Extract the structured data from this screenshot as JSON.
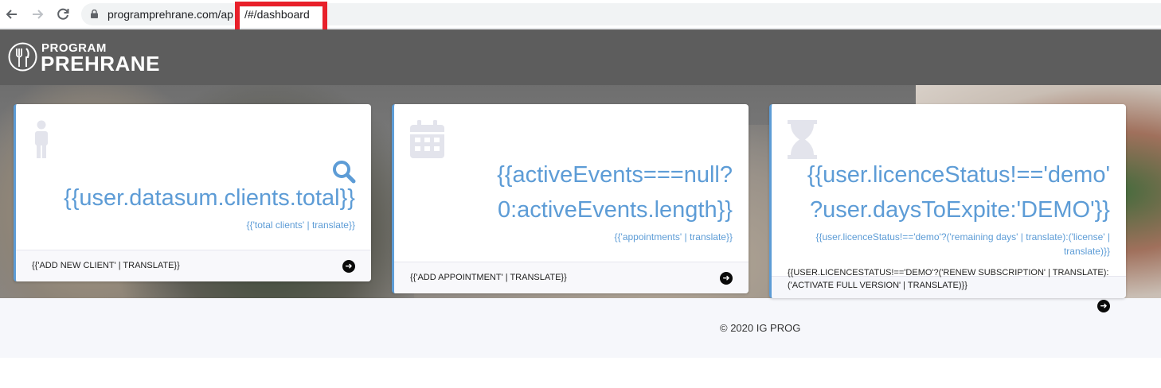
{
  "browser": {
    "url_host": "programprehrane.com/ap",
    "url_hash": "/#/dashboard",
    "back_icon": "arrow-left",
    "forward_icon": "arrow-right",
    "reload_icon": "reload"
  },
  "app": {
    "logo_top": "PROGRAM",
    "logo_bottom": "PREHRANE"
  },
  "cards": [
    {
      "icon": "person-icon",
      "secondary_icon": "search-icon",
      "value": "{{user.datasum.clients.total}}",
      "caption": "{{'total clients' | translate}}",
      "footer": "{{'ADD NEW CLIENT' | TRANSLATE}}"
    },
    {
      "icon": "calendar-icon",
      "value_line1": "{{activeEvents===null?",
      "value_line2": "0:activeEvents.length}}",
      "caption": "{{'appointments' | translate}}",
      "footer": "{{'ADD APPOINTMENT' | TRANSLATE}}"
    },
    {
      "icon": "hourglass-icon",
      "value_line1": "{{user.licenceStatus!=='demo'",
      "value_line2": "?user.daysToExpite:'DEMO'}}",
      "caption_line1": "{{user.licenceStatus!=='demo'?('remaining days' | translate):('license' |",
      "caption_line2": "translate)}}",
      "footer_line1": "{{USER.LICENCESTATUS!=='DEMO'?('RENEW SUBSCRIPTION' | TRANSLATE):",
      "footer_line2": "('ACTIVATE FULL VERSION' | TRANSLATE)}}"
    }
  ],
  "footer": {
    "copyright": "© 2020 IG PROG"
  },
  "colors": {
    "accent": "#5d9cd6",
    "highlight": "#e8202a"
  }
}
